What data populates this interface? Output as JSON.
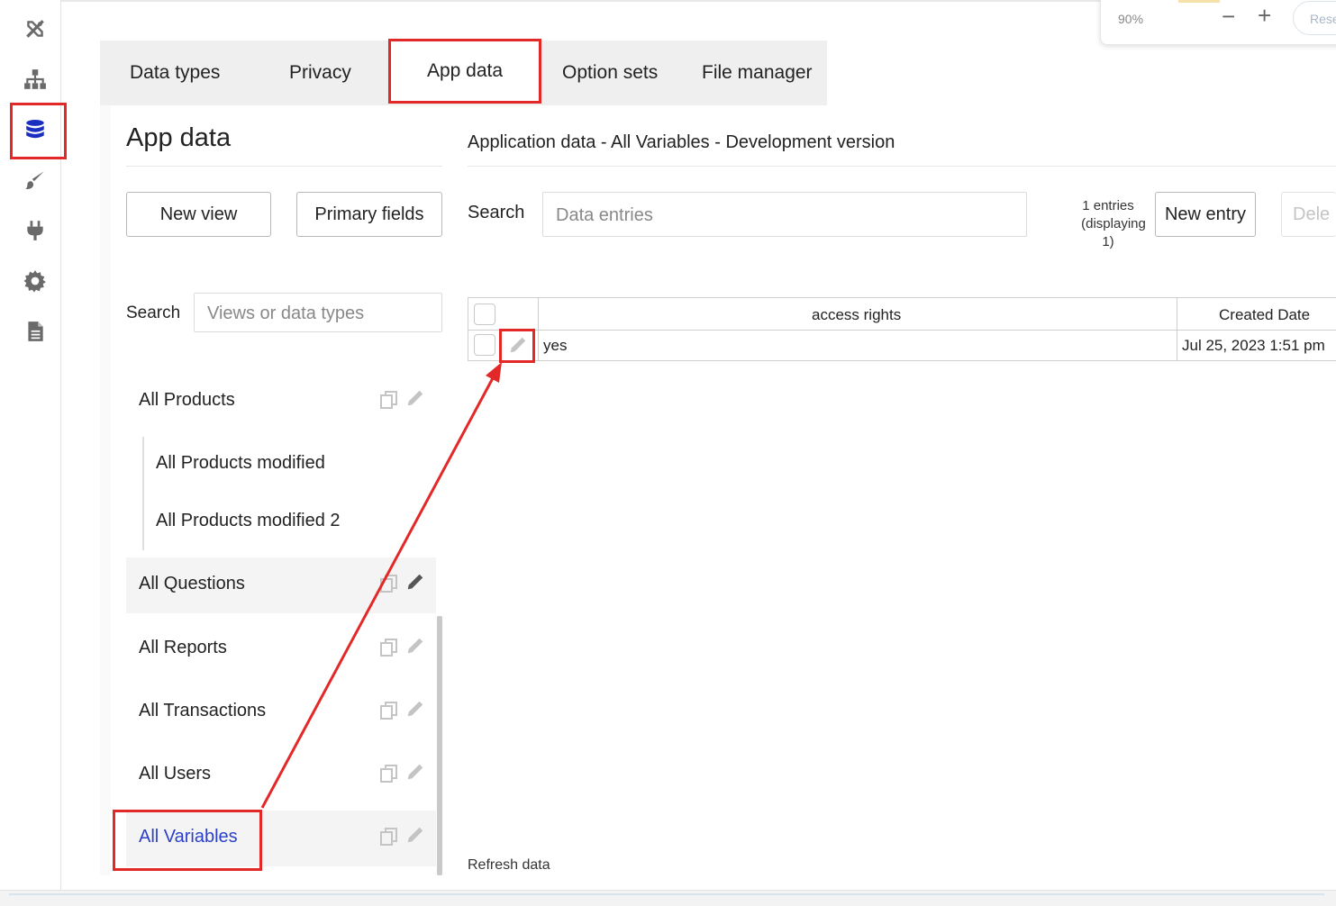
{
  "zoom": {
    "level": "90%",
    "minus": "−",
    "plus": "+",
    "reset_label": "Rese"
  },
  "tabs": [
    {
      "label": "Data types"
    },
    {
      "label": "Privacy"
    },
    {
      "label": "App data"
    },
    {
      "label": "Option sets"
    },
    {
      "label": "File manager"
    }
  ],
  "sidebar_icons": [
    "design-icon",
    "workflow-icon",
    "data-icon",
    "styles-icon",
    "plugins-icon",
    "settings-icon",
    "logs-icon"
  ],
  "left": {
    "title": "App data",
    "new_view_label": "New view",
    "primary_fields_label": "Primary fields",
    "search_label": "Search",
    "search_placeholder": "Views or data types",
    "items": [
      {
        "name": "All Products"
      },
      {
        "name": "All Products modified"
      },
      {
        "name": "All Products modified 2"
      },
      {
        "name": "All Questions"
      },
      {
        "name": "All Reports"
      },
      {
        "name": "All Transactions"
      },
      {
        "name": "All Users"
      },
      {
        "name": "All Variables"
      }
    ]
  },
  "right": {
    "heading": "Application data - All Variables - Development version",
    "search_label": "Search",
    "search_placeholder": "Data entries",
    "count_line1": "1 entries",
    "count_line2": "(displaying",
    "count_line3": "1)",
    "new_entry_label": "New entry",
    "delete_label": "Dele",
    "columns": [
      "access rights",
      "Created Date"
    ],
    "rows": [
      {
        "access_rights": "yes",
        "created_date": "Jul 25, 2023 1:51 pm"
      }
    ],
    "refresh_label": "Refresh data"
  },
  "colors": {
    "highlight_red": "#e32828",
    "active_blue": "#1a2fbf",
    "link_blue": "#2a3fcf"
  }
}
